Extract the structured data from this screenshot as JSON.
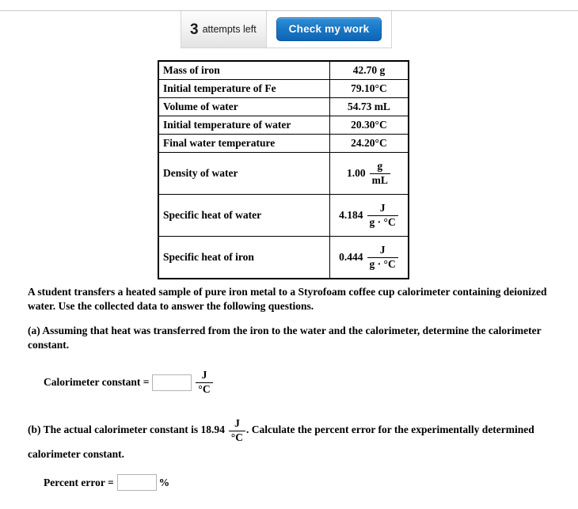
{
  "toolbar": {
    "attempts_count": "3",
    "attempts_label": "attempts left",
    "check_button_label": "Check my work",
    "button_color": "#1a78c8"
  },
  "data_table": {
    "rows": [
      {
        "label": "Mass of iron",
        "value": "42.70 g",
        "type": "plain"
      },
      {
        "label": "Initial temperature of Fe",
        "value": "79.10°C",
        "type": "plain"
      },
      {
        "label": "Volume of water",
        "value": "54.73 mL",
        "type": "plain"
      },
      {
        "label": "Initial temperature of water",
        "value": "20.30°C",
        "type": "plain"
      },
      {
        "label": "Final water temperature",
        "value": "24.20°C",
        "type": "plain"
      },
      {
        "label": "Density of water",
        "value": "1.00",
        "numerator": "g",
        "denominator": "mL",
        "type": "fraction"
      },
      {
        "label": "Specific heat of water",
        "value": "4.184",
        "numerator": "J",
        "denominator": "g · °C",
        "type": "fraction"
      },
      {
        "label": "Specific heat of iron",
        "value": "0.444",
        "numerator": "J",
        "denominator": "g · °C",
        "type": "fraction"
      }
    ]
  },
  "content": {
    "intro": "A student transfers a heated sample of pure iron metal to a Styrofoam coffee cup calorimeter containing deionized water. Use the collected data to answer the following questions.",
    "question_a": "(a)  Assuming that heat was transferred from the iron to the water and the calorimeter, determine the calorimeter constant.",
    "question_b_part1": "(b)  The actual calorimeter constant is 18.94",
    "question_b_part2": ". Calculate the percent error for the experimentally determined calorimeter constant.",
    "question_b_numerator": "J",
    "question_b_denominator": "°C"
  },
  "answers": {
    "a": {
      "label": "Calorimeter constant =",
      "value": "",
      "placeholder": "",
      "unit_numerator": "J",
      "unit_denominator": "°C"
    },
    "b": {
      "label": "Percent error =",
      "value": "",
      "placeholder": "",
      "unit": "%"
    }
  }
}
